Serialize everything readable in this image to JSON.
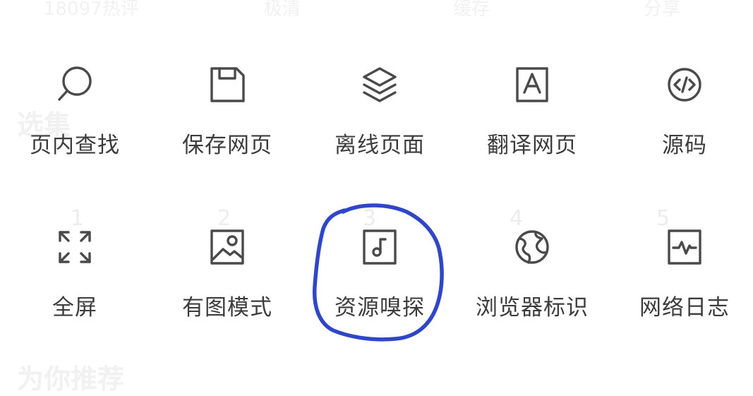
{
  "background": {
    "top_items": [
      "18097热评",
      "极清",
      "缓存",
      "分享"
    ],
    "section_title": "选集",
    "episodes": [
      "1",
      "2",
      "3",
      "4",
      "5"
    ],
    "bottom_title": "为你推荐"
  },
  "menu": {
    "row1": [
      {
        "label": "页内查找",
        "icon": "search-icon"
      },
      {
        "label": "保存网页",
        "icon": "save-icon"
      },
      {
        "label": "离线页面",
        "icon": "layers-icon"
      },
      {
        "label": "翻译网页",
        "icon": "translate-icon"
      },
      {
        "label": "源码",
        "icon": "code-icon"
      }
    ],
    "row2": [
      {
        "label": "全屏",
        "icon": "fullscreen-icon"
      },
      {
        "label": "有图模式",
        "icon": "image-icon"
      },
      {
        "label": "资源嗅探",
        "icon": "music-note-icon"
      },
      {
        "label": "浏览器标识",
        "icon": "globe-icon"
      },
      {
        "label": "网络日志",
        "icon": "activity-icon"
      }
    ]
  },
  "colors": {
    "icon": "#4a4a4a",
    "label": "#3c3c3c",
    "annotation": "#2f46c8"
  }
}
